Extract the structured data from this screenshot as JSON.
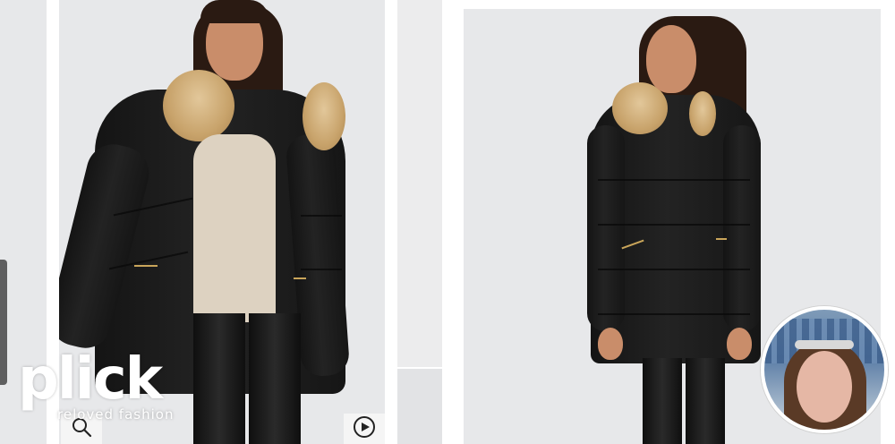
{
  "logo": {
    "text": "plick",
    "tagline": "reloved fashion"
  },
  "icons": {
    "zoom": "magnifier-icon",
    "play": "play-icon"
  },
  "colors": {
    "panel_background": "#e7e8ea",
    "coat": "#1a1a1a",
    "fur": "#d2b27d",
    "logo": "#ffffff"
  }
}
